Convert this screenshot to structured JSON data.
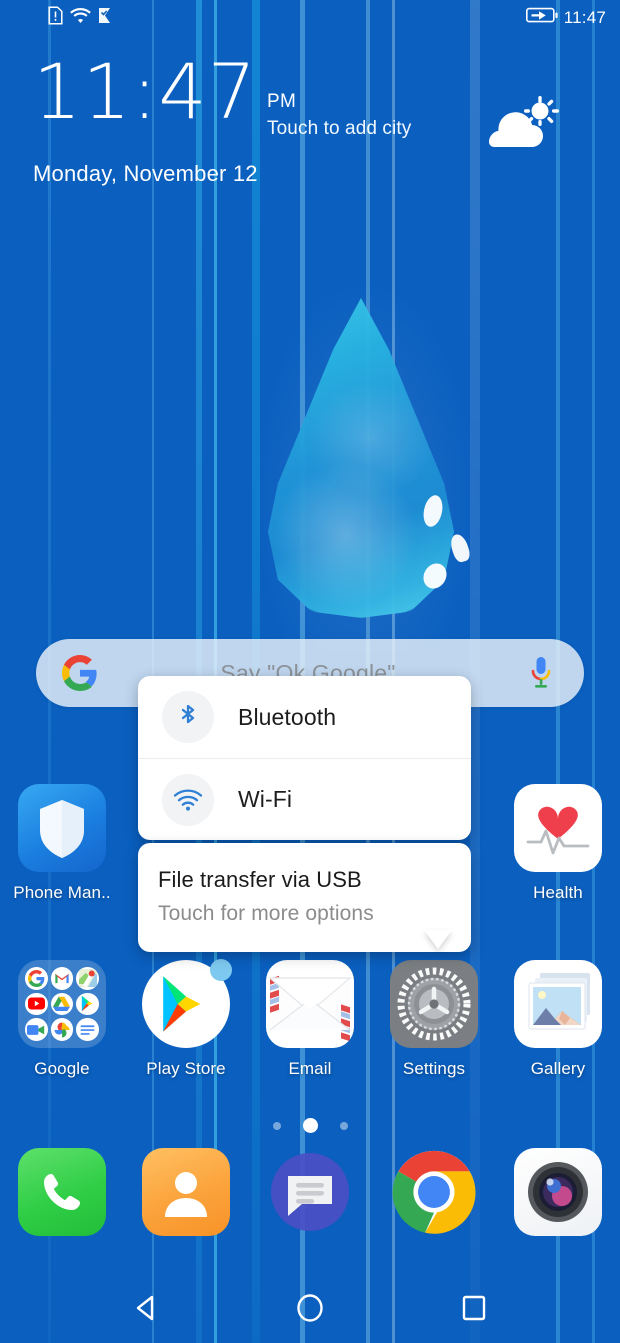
{
  "status_bar": {
    "icons": [
      "sim-alert-icon",
      "wifi-icon",
      "vpn-flag-icon"
    ],
    "battery_icon": "battery-charging-icon",
    "time": "11:47"
  },
  "clock_widget": {
    "time": "11:47",
    "meridiem": "PM",
    "city_hint": "Touch to add city",
    "date": "Monday, November 12",
    "weather_icon": "partly-cloudy-icon"
  },
  "search": {
    "placeholder": "Say \"Ok Google\"",
    "google_icon": "google-g-icon",
    "mic_icon": "microphone-icon"
  },
  "home": {
    "rows": [
      {
        "apps": [
          {
            "label": "Phone Man..",
            "icon": "shield-icon"
          },
          {
            "label": "",
            "icon": ""
          },
          {
            "label": "",
            "icon": ""
          },
          {
            "label": "",
            "icon": ""
          },
          {
            "label": "Health",
            "icon": "heart-pulse-icon"
          }
        ]
      },
      {
        "apps": [
          {
            "label": "Google",
            "icon": "google-folder-icon"
          },
          {
            "label": "Play Store",
            "icon": "play-store-icon"
          },
          {
            "label": "Email",
            "icon": "envelope-icon"
          },
          {
            "label": "Settings",
            "icon": "gear-icon"
          },
          {
            "label": "Gallery",
            "icon": "photo-stack-icon"
          }
        ]
      }
    ],
    "folder_apps": [
      "google-search",
      "gmail",
      "maps",
      "youtube",
      "drive",
      "play",
      "meet",
      "photos",
      "docs"
    ],
    "dock": [
      {
        "label": "",
        "icon": "phone-handset-icon"
      },
      {
        "label": "",
        "icon": "contacts-person-icon"
      },
      {
        "label": "",
        "icon": "messages-bubble-icon"
      },
      {
        "label": "",
        "icon": "chrome-icon"
      },
      {
        "label": "",
        "icon": "camera-lens-icon"
      }
    ],
    "page_dots": {
      "count": 3,
      "active_index": 1
    }
  },
  "usb_popup": {
    "options": [
      {
        "label": "Bluetooth",
        "icon": "bluetooth-icon"
      },
      {
        "label": "Wi-Fi",
        "icon": "wifi-icon"
      }
    ],
    "notification_title": "File transfer via USB",
    "notification_subtitle": "Touch for more options"
  },
  "nav_bar": {
    "back": "back-triangle-icon",
    "home": "home-circle-icon",
    "recents": "recents-square-icon"
  },
  "colors": {
    "wallpaper_deep_blue": "#0062c2",
    "wallpaper_cyan": "#00f0fb",
    "accent_blue": "#2f7fd4",
    "popup_bg": "#ffffff",
    "popup_subtitle": "#8c8c8c"
  }
}
